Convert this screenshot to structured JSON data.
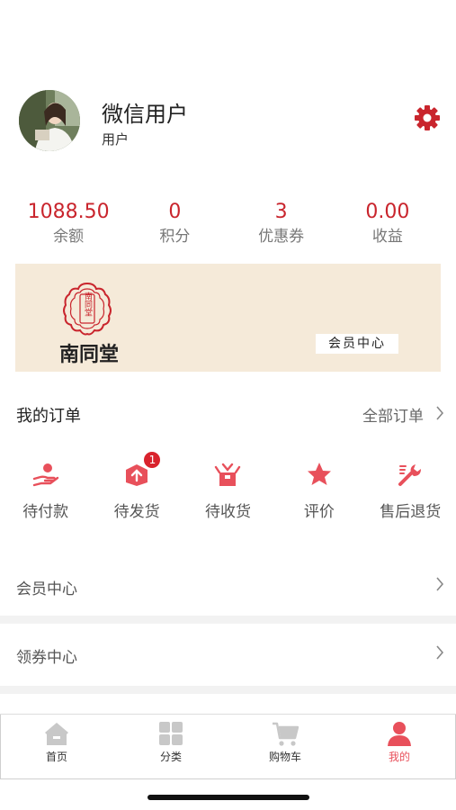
{
  "profile": {
    "name": "微信用户",
    "role": "用户"
  },
  "stats": [
    {
      "value": "1088.50",
      "label": "余额"
    },
    {
      "value": "0",
      "label": "积分"
    },
    {
      "value": "3",
      "label": "优惠券"
    },
    {
      "value": "0.00",
      "label": "收益"
    }
  ],
  "banner": {
    "brand": "南同堂",
    "seal_text": "南同堂",
    "member_tag": "会员中心"
  },
  "orders": {
    "title": "我的订单",
    "all_label": "全部订单",
    "items": [
      {
        "label": "待付款",
        "icon": "hand-coin-icon"
      },
      {
        "label": "待发货",
        "icon": "box-upload-icon",
        "badge": "1"
      },
      {
        "label": "待收货",
        "icon": "package-open-icon"
      },
      {
        "label": "评价",
        "icon": "star-icon"
      },
      {
        "label": "售后退货",
        "icon": "wrench-icon"
      }
    ]
  },
  "menu": [
    {
      "label": "会员中心"
    },
    {
      "label": "领券中心"
    }
  ],
  "tabbar": [
    {
      "label": "首页",
      "icon": "home-icon"
    },
    {
      "label": "分类",
      "icon": "grid-icon"
    },
    {
      "label": "购物车",
      "icon": "cart-icon"
    },
    {
      "label": "我的",
      "icon": "user-icon",
      "active": true
    }
  ],
  "colors": {
    "accent": "#c9252d",
    "active_tab": "#e8505b",
    "inactive_tab": "#c8c8c8",
    "banner_bg": "#f5ead9"
  }
}
